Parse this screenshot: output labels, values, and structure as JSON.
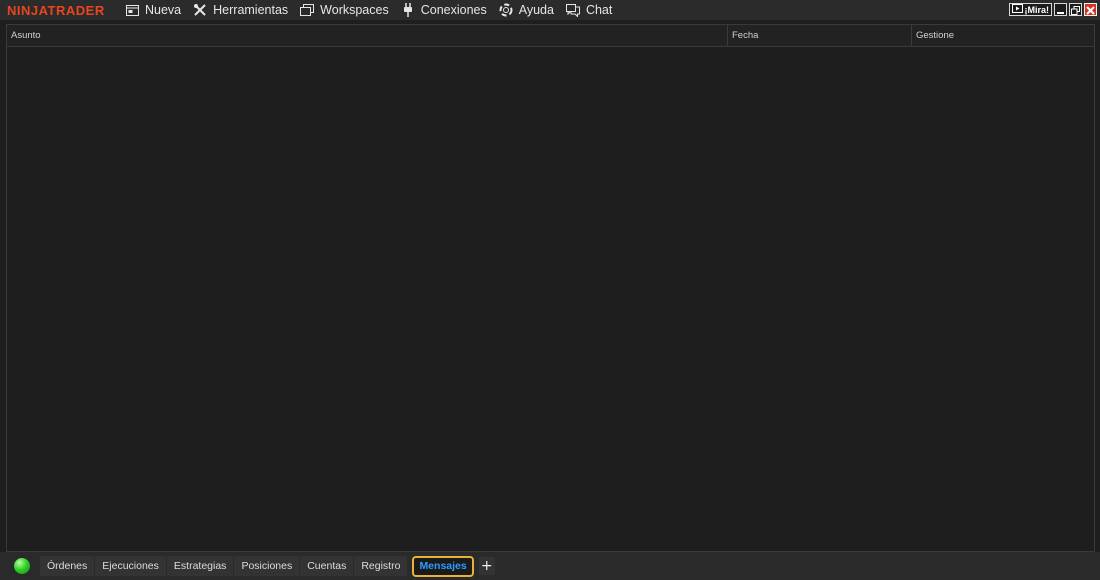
{
  "app": {
    "logo": "NINJATRADER",
    "brand_color": "#e8461e"
  },
  "menu": [
    {
      "label": "Nueva",
      "icon": "new-window-icon"
    },
    {
      "label": "Herramientas",
      "icon": "tools-icon"
    },
    {
      "label": "Workspaces",
      "icon": "workspaces-icon"
    },
    {
      "label": "Conexiones",
      "icon": "plug-icon"
    },
    {
      "label": "Ayuda",
      "icon": "help-lifebuoy-icon"
    },
    {
      "label": "Chat",
      "icon": "chat-icon"
    }
  ],
  "window_controls": {
    "mira_label": "¡Mira!",
    "icons": [
      "video-icon",
      "minimize-icon",
      "restore-icon",
      "close-icon"
    ]
  },
  "grid": {
    "columns": [
      "Asunto",
      "Fecha",
      "Gestione"
    ],
    "rows": []
  },
  "tabs": {
    "status_color": "#33d12a",
    "items": [
      "Órdenes",
      "Ejecuciones",
      "Estrategias",
      "Posiciones",
      "Cuentas",
      "Registro",
      "Mensajes"
    ],
    "active_index": 6,
    "add_label": "+"
  }
}
